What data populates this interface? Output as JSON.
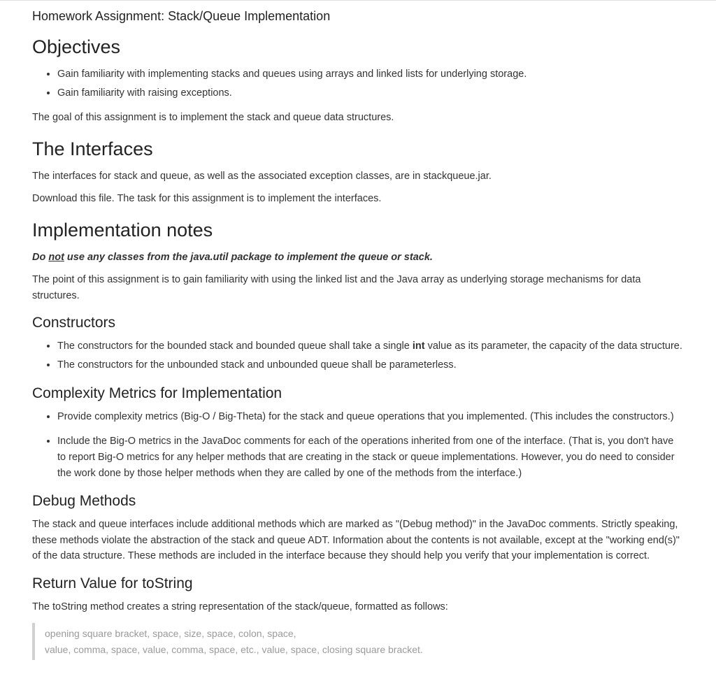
{
  "title": "Homework Assignment: Stack/Queue Implementation",
  "sections": {
    "objectives": {
      "heading": "Objectives",
      "bullets": [
        "Gain familiarity with implementing stacks and queues using arrays and linked lists for underlying storage.",
        "Gain familiarity with raising exceptions."
      ],
      "para": "The goal of this assignment is to implement the stack and queue data structures."
    },
    "interfaces": {
      "heading": "The Interfaces",
      "para1": "The interfaces for stack and queue, as well as the associated exception classes, are in stackqueue.jar.",
      "para2": "Download this file. The task for this assignment is to implement the interfaces."
    },
    "impl": {
      "heading": "Implementation notes",
      "warn_pre": "Do ",
      "warn_not": "not",
      "warn_post": " use any classes from the java.util package to implement the queue or stack.",
      "para": "The point of this assignment is to gain familiarity with using the linked list and the Java array as underlying storage mechanisms for data structures."
    },
    "constructors": {
      "heading": "Constructors",
      "b1_pre": "The constructors for the bounded stack and bounded queue shall take a single ",
      "b1_bold": "int",
      "b1_post": " value as its parameter, the capacity of the data structure.",
      "b2": "The constructors for the unbounded stack and unbounded queue shall be parameterless."
    },
    "complexity": {
      "heading": "Complexity Metrics for Implementation",
      "b1": "Provide complexity metrics (Big-O / Big-Theta) for the stack and queue operations that you implemented. (This includes the constructors.)",
      "b2": "Include the Big-O metrics in the JavaDoc comments for each of the operations inherited from one of the interface. (That is, you don't have to report Big-O metrics for any helper methods that are creating in the stack or queue implementations. However, you do need to consider the work done by those helper methods when they are called by one of the methods from the interface.)"
    },
    "debug": {
      "heading": "Debug Methods",
      "para": "The stack and queue interfaces include additional methods which are marked as \"(Debug method)\" in the JavaDoc comments. Strictly speaking, these methods violate the abstraction of the stack and queue ADT. Information about the contents is not available, except at the \"working end(s)\" of the data structure. These methods are included in the interface because they should help you verify that your implementation is correct."
    },
    "tostring": {
      "heading": "Return Value for toString",
      "para": "The toString method creates a string representation of the stack/queue, formatted as follows:",
      "block_l1": "opening square bracket, space, size, space, colon, space,",
      "block_l2": "value, comma, space, value, comma, space, etc., value, space, closing square bracket."
    }
  }
}
